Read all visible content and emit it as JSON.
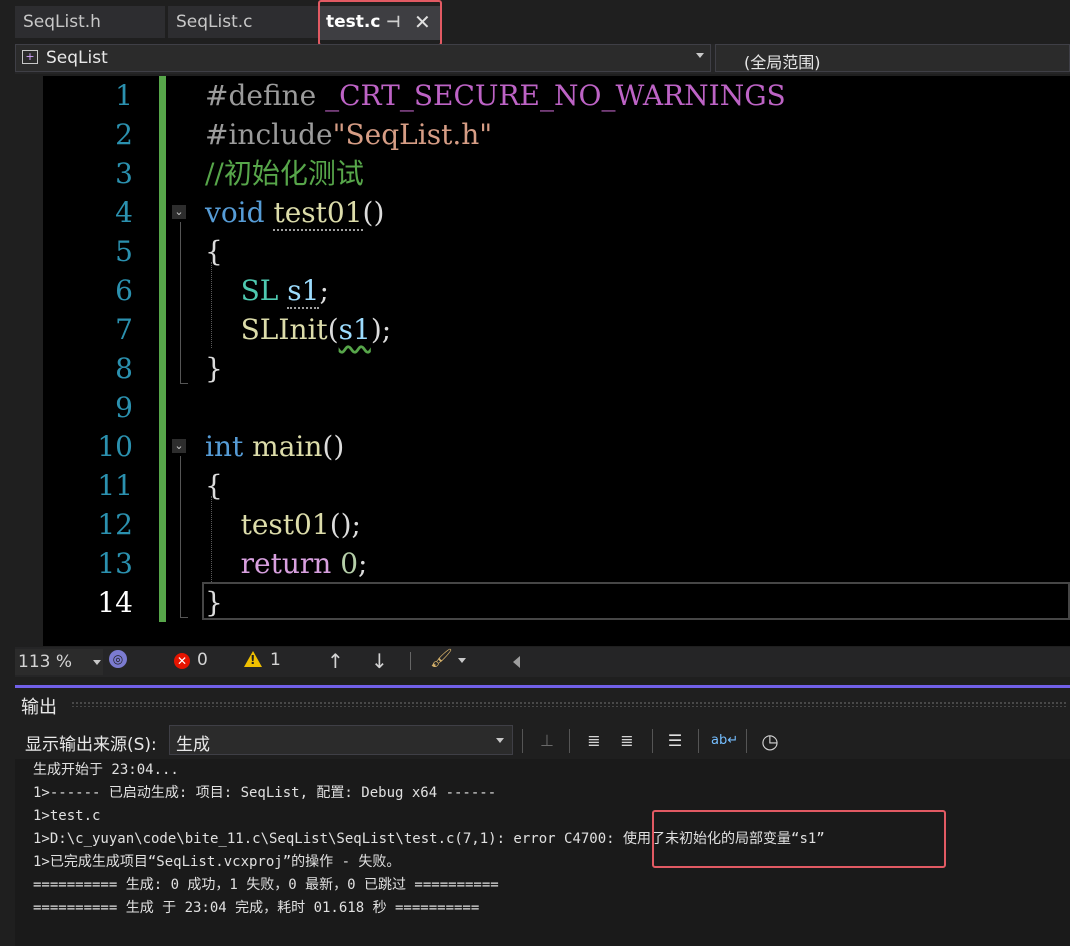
{
  "tabs": [
    {
      "label": "SeqList.h"
    },
    {
      "label": "SeqList.c"
    },
    {
      "label": "test.c",
      "active": true
    }
  ],
  "navbar": {
    "scope_label": "SeqList",
    "member_label": "(全局范围)"
  },
  "editor": {
    "line_numbers": [
      "1",
      "2",
      "3",
      "4",
      "5",
      "6",
      "7",
      "8",
      "9",
      "10",
      "11",
      "12",
      "13",
      "14"
    ],
    "current_line": "14",
    "code": {
      "l1_directive": "#define",
      "l1_macro": " _CRT_SECURE_NO_WARNINGS",
      "l2_directive": "#include",
      "l2_string": "\"SeqList.h\"",
      "l3_comment": "//初始化测试",
      "l4_kw": "void",
      "l4_fn": "test01",
      "l4_rest": "()",
      "l5": "{",
      "l6_type": "SL",
      "l6_var": "s1",
      "l6_rest": ";",
      "l7_fn": "SLInit",
      "l7_open": "(",
      "l7_var": "s1",
      "l7_rest": ");",
      "l8": "}",
      "l10_kw": "int",
      "l10_fn": "main",
      "l10_rest": "()",
      "l11": "{",
      "l12_fn": "test01",
      "l12_rest": "();",
      "l13_kw": "return",
      "l13_num": "0",
      "l13_rest": ";",
      "l14": "}"
    }
  },
  "status": {
    "zoom": "113 %",
    "errors": "0",
    "warnings": "1"
  },
  "output": {
    "title": "输出",
    "source_label": "显示输出来源(S):",
    "source_value": "生成",
    "lines": [
      "生成开始于 23:04...",
      "1>------ 已启动生成: 项目: SeqList, 配置: Debug x64 ------",
      "1>test.c",
      "1>D:\\c_yuyan\\code\\bite_11.c\\SeqList\\SeqList\\test.c(7,1): error C4700: 使用了未初始化的局部变量“s1”",
      "1>已完成生成项目“SeqList.vcxproj”的操作 - 失败。",
      "========== 生成: 0 成功，1 失败，0 最新，0 已跳过 ==========",
      "========== 生成 于 23:04 完成，耗时 01.618 秒 =========="
    ]
  },
  "colors": {
    "highlight_box": "#e25a63",
    "change_bar": "#57a64a",
    "output_accent": "#7160e8"
  }
}
